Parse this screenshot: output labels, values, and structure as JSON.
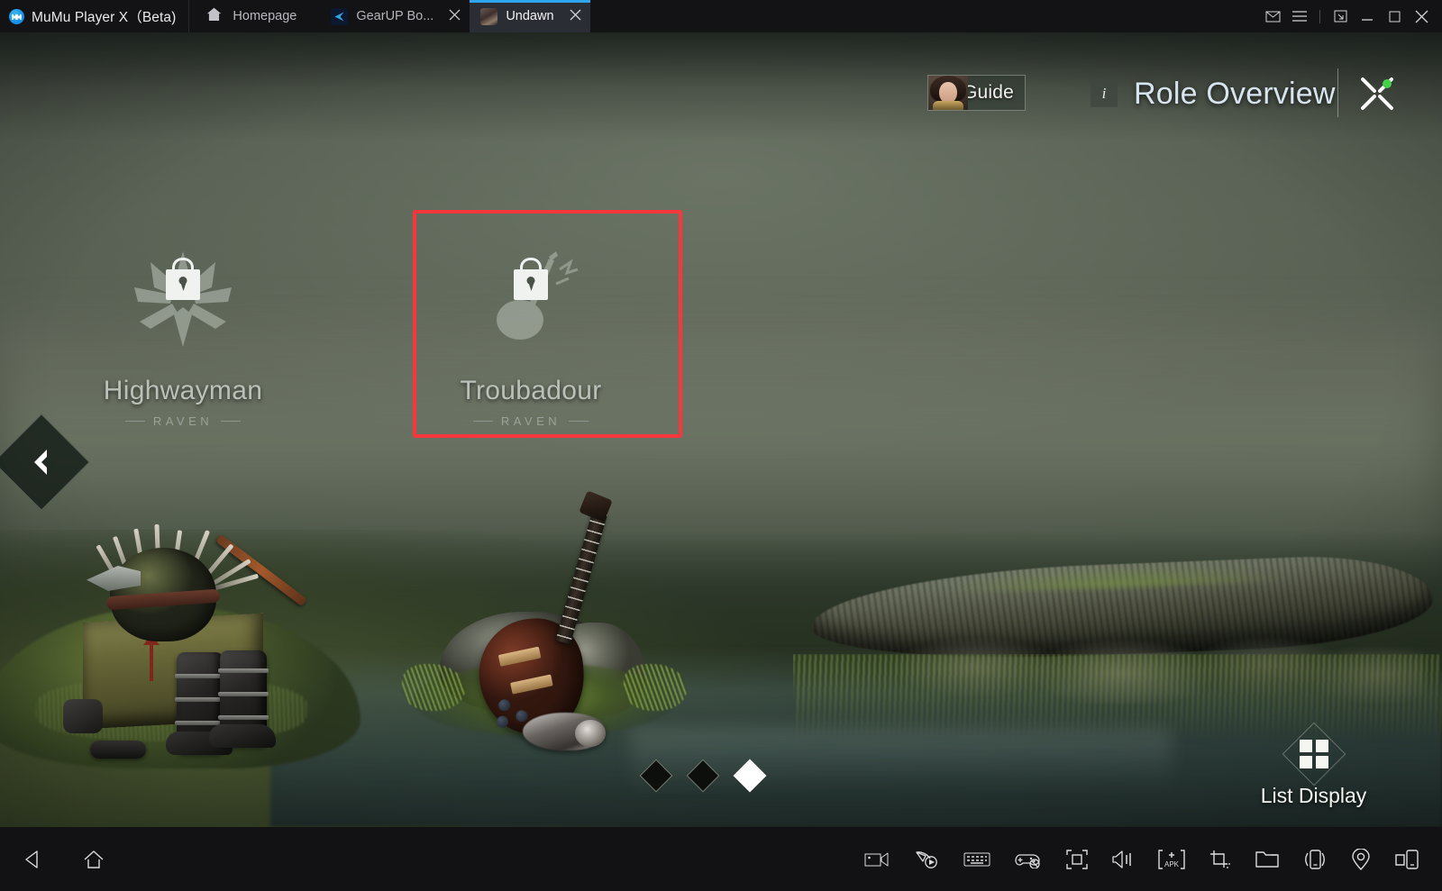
{
  "titlebar": {
    "app_name": "MuMu Player X（Beta)",
    "app_logo_icon": "mumu-logo-icon",
    "home_label": "Homepage",
    "home_icon": "home-icon",
    "tabs": [
      {
        "label": "GearUP Bo...",
        "icon": "gearup-booster-icon",
        "close_icon": "close-icon",
        "active": false
      },
      {
        "label": "Undawn",
        "icon": "undawn-app-icon",
        "close_icon": "close-icon",
        "active": true
      }
    ],
    "system_buttons": [
      {
        "name": "mail-icon",
        "glyph": "mail"
      },
      {
        "name": "menu-icon",
        "glyph": "hamburger"
      },
      {
        "name": "resize-icon",
        "glyph": "resize"
      },
      {
        "name": "minimize-icon",
        "glyph": "minimize"
      },
      {
        "name": "maximize-icon",
        "glyph": "maximize"
      },
      {
        "name": "close-icon",
        "glyph": "close"
      }
    ]
  },
  "game": {
    "header": {
      "guide_label": "Guide",
      "guide_avatar_icon": "guide-avatar-icon",
      "info_badge": "i",
      "title": "Role Overview",
      "collapse_icon": "collapse-cross-icon",
      "collapse_dot_color": "#44d14a"
    },
    "classes": [
      {
        "name": "Highwayman",
        "faction": "RAVEN",
        "icon": "spiked-mace-icon",
        "locked": true,
        "lock_icon": "padlock-icon",
        "selected": false
      },
      {
        "name": "Troubadour",
        "faction": "RAVEN",
        "icon": "guitar-icon",
        "locked": true,
        "lock_icon": "padlock-icon",
        "selected": true
      }
    ],
    "selection_highlight_color": "#f7373c",
    "nav_prev_icon": "chevron-left-icon",
    "pagination": {
      "total": 3,
      "active_index": 2
    },
    "list_display": {
      "label": "List Display",
      "icon": "grid-2x2-icon"
    }
  },
  "bottombar": {
    "left_buttons": [
      {
        "name": "back-icon",
        "glyph": "back"
      },
      {
        "name": "home-icon",
        "glyph": "home"
      }
    ],
    "right_buttons": [
      {
        "name": "record-video-icon",
        "glyph": "video"
      },
      {
        "name": "macro-record-icon",
        "glyph": "macro"
      },
      {
        "name": "keyboard-mapping-icon",
        "glyph": "keyboard"
      },
      {
        "name": "gamepad-disabled-icon",
        "glyph": "gamepad"
      },
      {
        "name": "fullscreen-icon",
        "glyph": "fullscreen"
      },
      {
        "name": "volume-icon",
        "glyph": "volume"
      },
      {
        "name": "install-apk-icon",
        "glyph": "apk",
        "label": "APK"
      },
      {
        "name": "screenshot-crop-icon",
        "glyph": "crop"
      },
      {
        "name": "shared-folder-icon",
        "glyph": "folder"
      },
      {
        "name": "shake-device-icon",
        "glyph": "shake"
      },
      {
        "name": "location-icon",
        "glyph": "location"
      },
      {
        "name": "multi-instance-icon",
        "glyph": "multi"
      }
    ]
  }
}
